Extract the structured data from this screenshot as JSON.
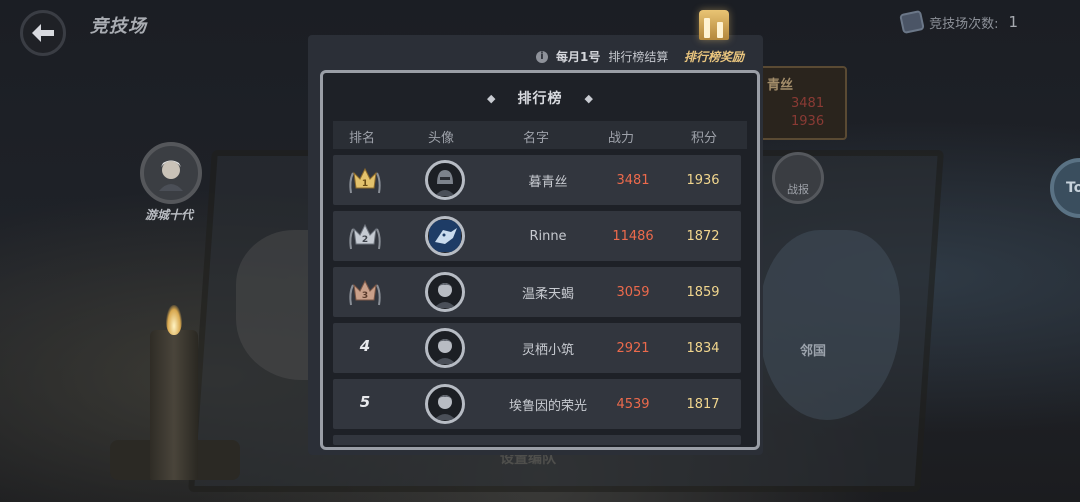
{
  "top_bar": {
    "title": "竞技场",
    "arena_count_label": "竞技场次数:",
    "arena_count_value": "1"
  },
  "background": {
    "left_player_name": "游城十代",
    "right_card_name": "青丝",
    "right_card_value_1": "3481",
    "right_card_value_2": "1936",
    "battle_report_label": "战报",
    "neighbor_label": "邻国",
    "edge_button_label": "To",
    "bottom_hint": "设置编队"
  },
  "rules": {
    "info_icon": "i",
    "date": "每月1号",
    "settle_text": "排行榜结算",
    "reward_tab": "排行榜奖励"
  },
  "leaderboard": {
    "title": "排行榜",
    "columns": {
      "rank": "排名",
      "avatar": "头像",
      "name": "名字",
      "power": "战力",
      "score": "积分"
    },
    "rows": [
      {
        "rank": "1",
        "badge": "gold",
        "name": "暮青丝",
        "power": "3481",
        "score": "1936"
      },
      {
        "rank": "2",
        "badge": "silver",
        "name": "Rinne",
        "power": "11486",
        "score": "1872"
      },
      {
        "rank": "3",
        "badge": "bronze",
        "name": "温柔天蝎",
        "power": "3059",
        "score": "1859"
      },
      {
        "rank": "4",
        "badge": "none",
        "name": "灵栖小筑",
        "power": "2921",
        "score": "1834"
      },
      {
        "rank": "5",
        "badge": "none",
        "name": "埃鲁因的荣光",
        "power": "4539",
        "score": "1817"
      }
    ]
  },
  "colors": {
    "power": "#ec6a4c",
    "score": "#f1d68e",
    "gold_badge": "#e3c26c",
    "silver_badge": "#c6cbd3",
    "bronze_badge": "#c9a08a"
  }
}
